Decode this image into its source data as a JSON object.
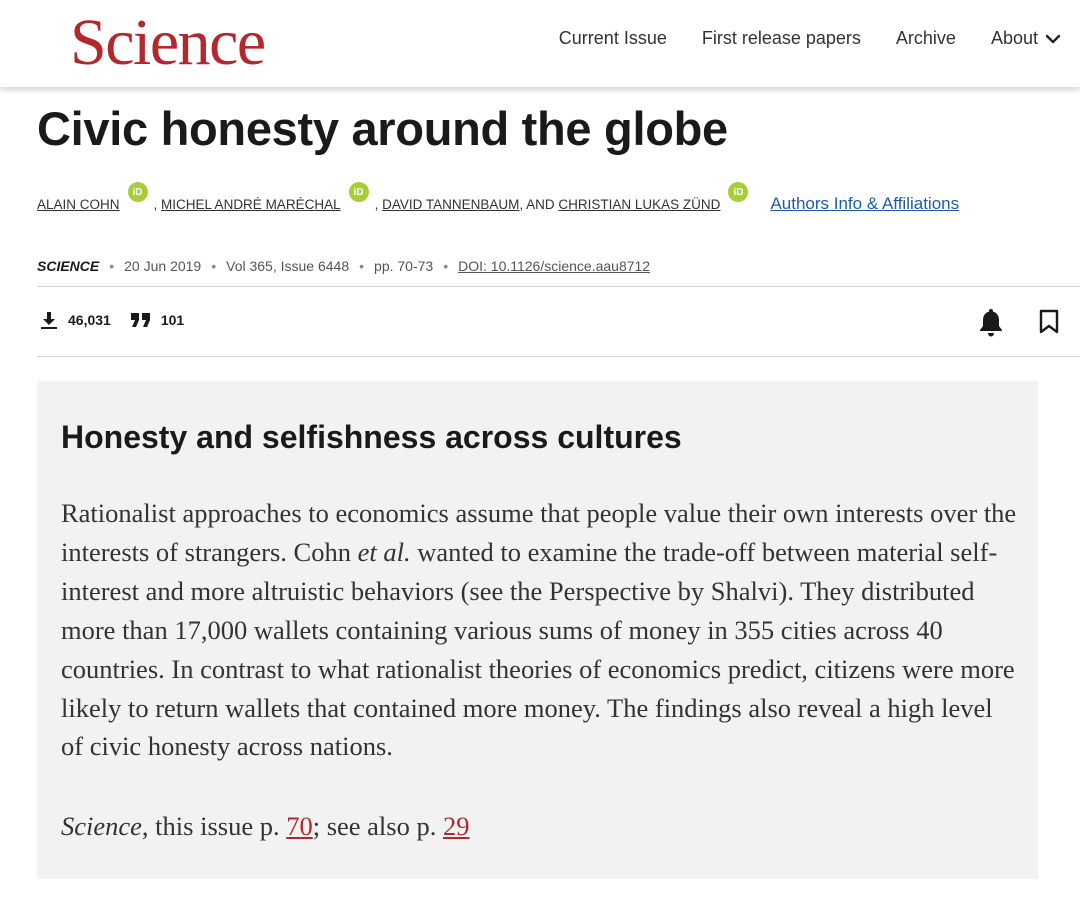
{
  "header": {
    "logo": "Science",
    "nav": [
      "Current Issue",
      "First release papers",
      "Archive",
      "About"
    ]
  },
  "article": {
    "title": "Civic honesty around the globe",
    "authors": [
      "ALAIN COHN",
      "MICHEL ANDRÉ MARÉCHAL",
      "DAVID TANNENBAUM",
      "CHRISTIAN LUKAS ZÜND"
    ],
    "author_separators": [
      ", ",
      ", ",
      ", AND "
    ],
    "orcid_badge": "iD",
    "affiliations_link": "Authors Info & Affiliations",
    "journal": "SCIENCE",
    "date": "20 Jun 2019",
    "volume_issue": "Vol 365, Issue 6448",
    "pages": "pp. 70-73",
    "doi": "DOI: 10.1126/science.aau8712",
    "meta_separator": "•",
    "downloads": "46,031",
    "citations": "101"
  },
  "abstract": {
    "heading": "Honesty and selfishness across cultures",
    "text_part1": "Rationalist approaches to economics assume that people value their own interests over the interests of strangers. Cohn ",
    "text_italic": "et al.",
    "text_part2": " wanted to examine the trade-off be­tween material self-interest and more altruistic behaviors (see the Perspective by Shalvi). They distributed more than 17,000 wallets containing various sums of money in 355 cities across 40 countries. In contrast to what rationalist theories of economics predict, citizens were more likely to return wallets that contained more money. The findings also reveal a high level of civic honesty across nations.",
    "ref_journal": "Science",
    "ref_middle": ", this issue p. ",
    "ref_page1": "70",
    "ref_see_also": "; see also p. ",
    "ref_page2": "29"
  },
  "icons": {
    "download": "download-icon",
    "quote": "quote-icon",
    "bell": "bell-icon",
    "bookmark": "bookmark-icon",
    "chevron": "chevron-down-icon",
    "orcid": "orcid-icon"
  },
  "colors": {
    "brand": "#b3282d",
    "link": "#1f5bab",
    "orcid": "#a6ce39",
    "abstract_bg": "#f2f2f2"
  }
}
